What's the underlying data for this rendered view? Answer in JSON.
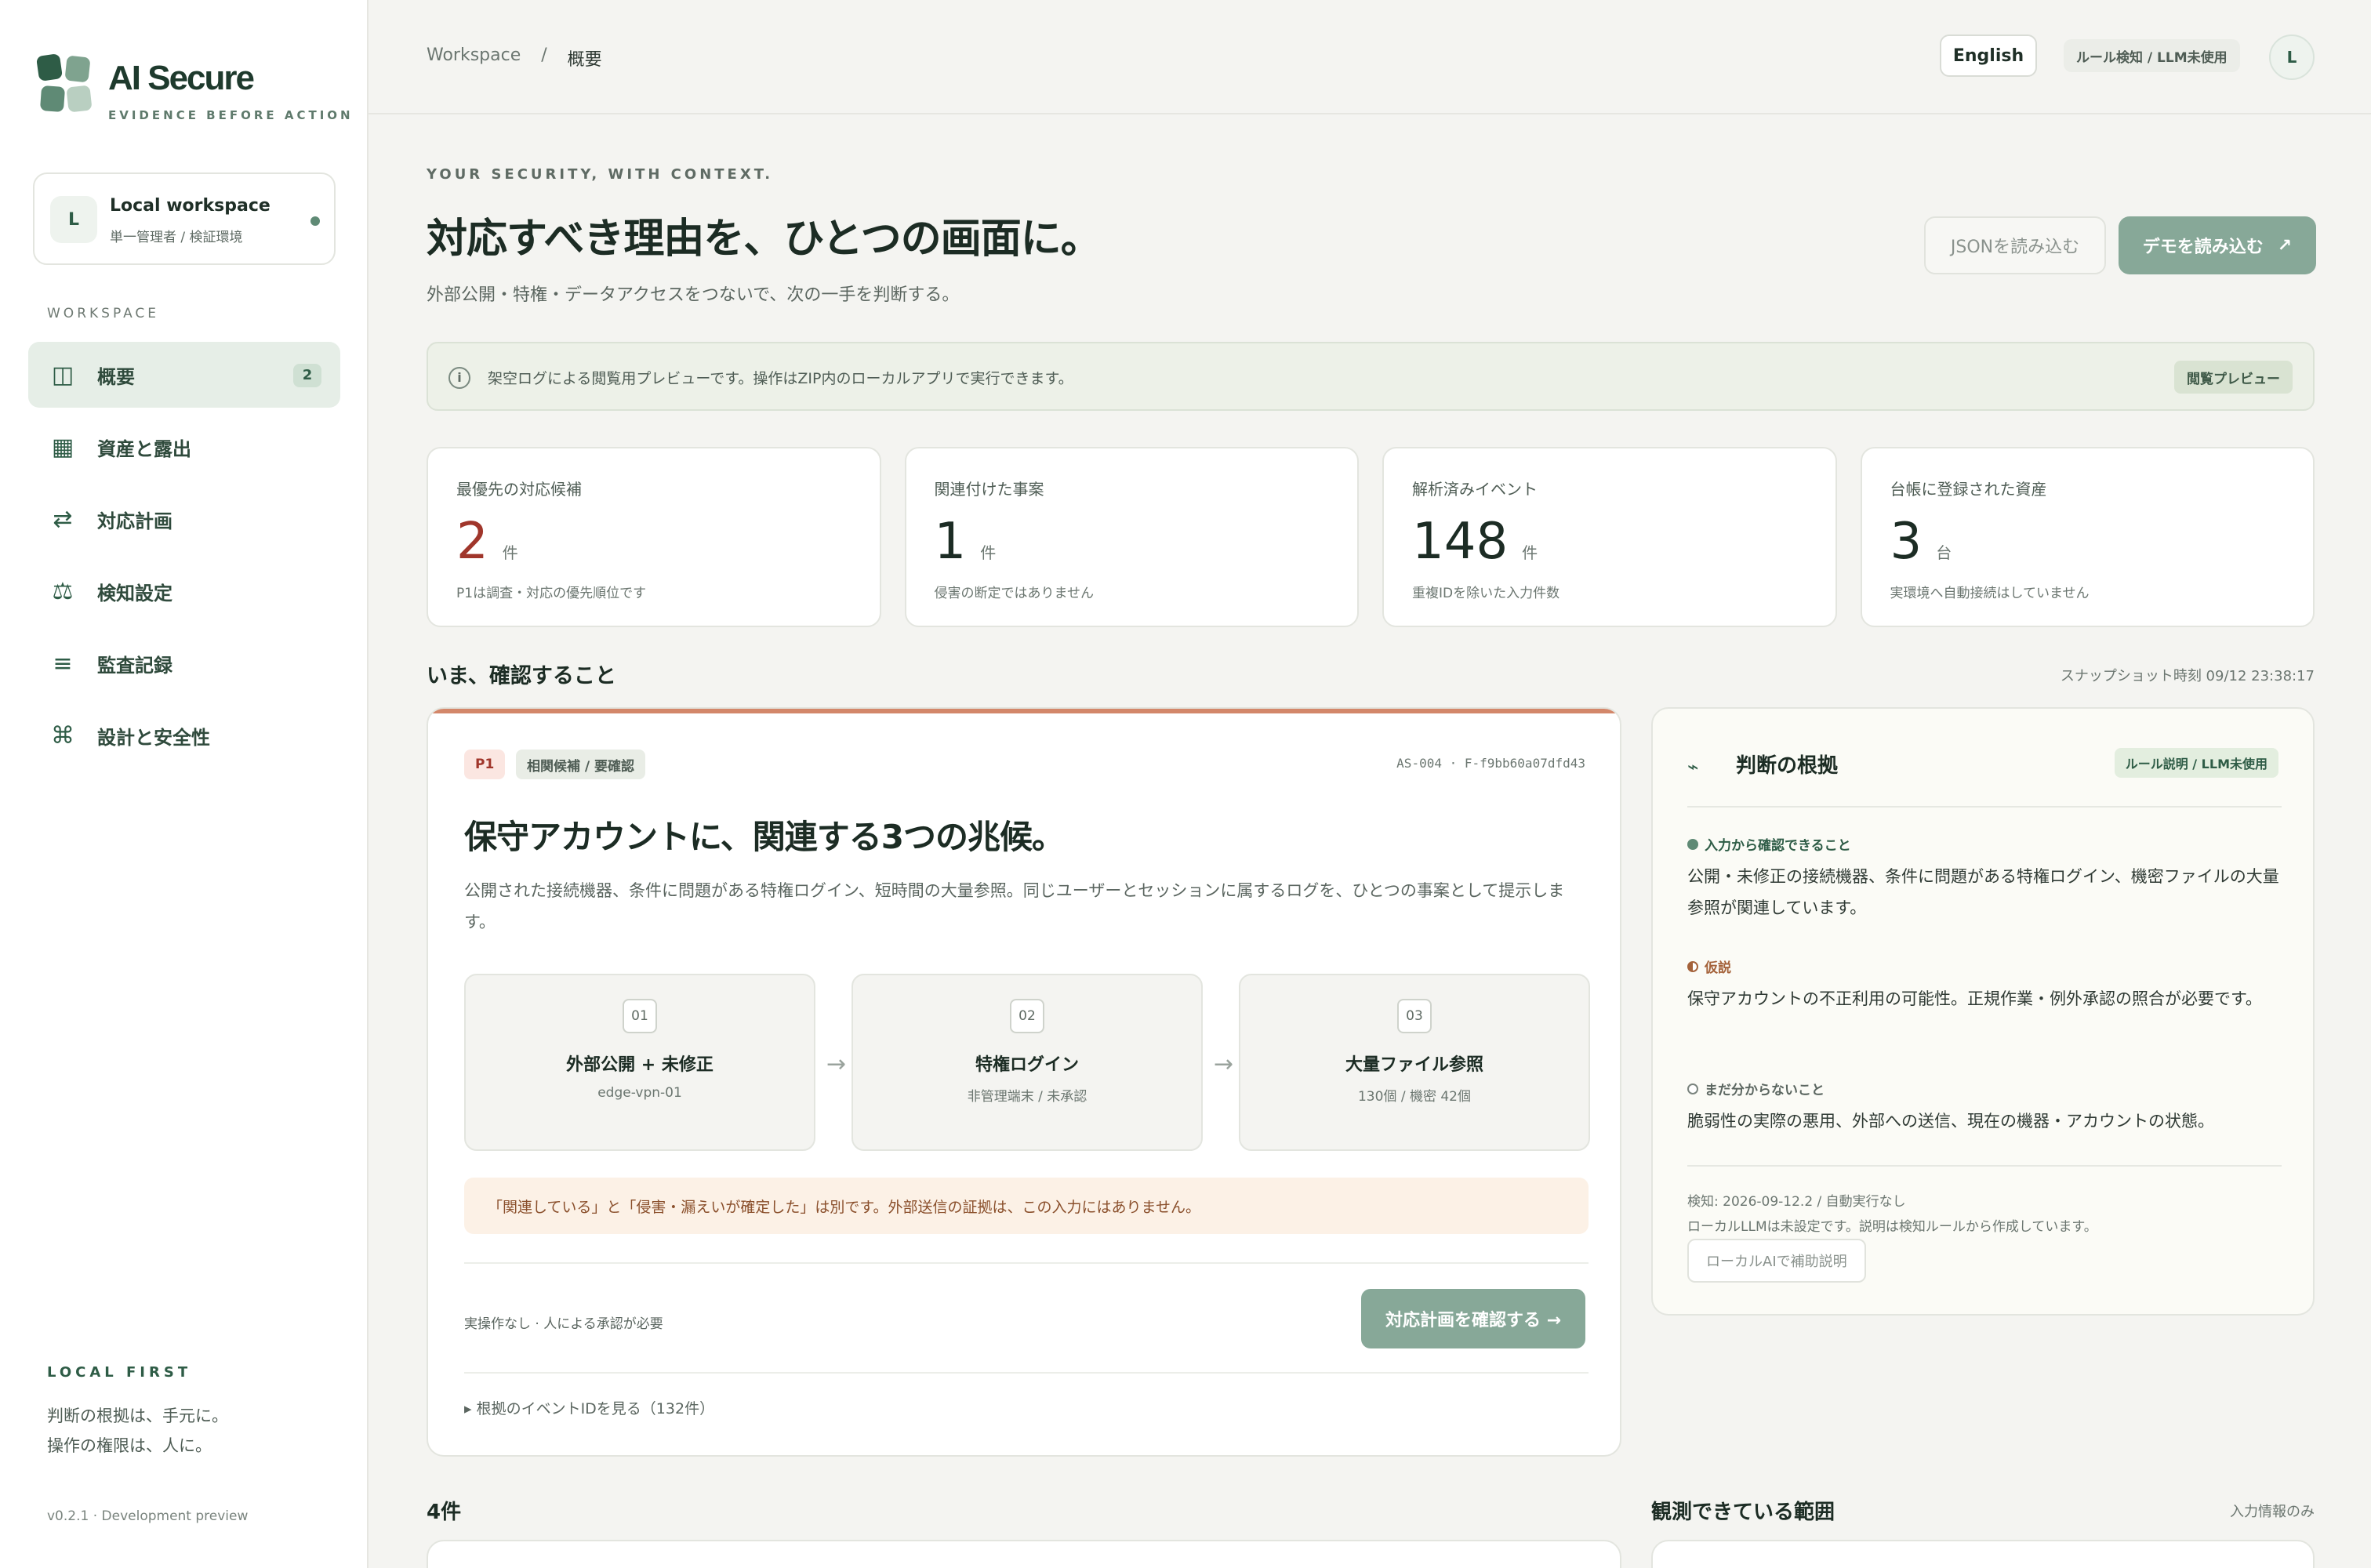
{
  "app": {
    "name": "AI Secure",
    "tagline": "EVIDENCE BEFORE ACTION"
  },
  "workspace": {
    "initial": "L",
    "name": "Local workspace",
    "sub": "単一管理者 / 検証環境"
  },
  "sidebar": {
    "section": "WORKSPACE",
    "items": [
      {
        "label": "概要",
        "icon": "overview-icon",
        "badge": "2"
      },
      {
        "label": "資産と露出",
        "icon": "grid-icon"
      },
      {
        "label": "対応計画",
        "icon": "swap-arrows-icon"
      },
      {
        "label": "検知設定",
        "icon": "scale-icon"
      },
      {
        "label": "監査記録",
        "icon": "list-icon"
      },
      {
        "label": "設計と安全性",
        "icon": "command-icon"
      }
    ],
    "local_first": {
      "title": "LOCAL FIRST",
      "line1": "判断の根拠は、手元に。",
      "line2": "操作の権限は、人に。"
    },
    "version": "v0.2.1 · Development preview"
  },
  "header": {
    "breadcrumb": [
      "Workspace",
      "/",
      "概要"
    ],
    "lang": "English",
    "mode": "ルール検知 / LLM未使用",
    "user_initial": "L"
  },
  "main": {
    "eyebrow": "YOUR SECURITY, WITH CONTEXT.",
    "title": "対応すべき理由を、ひとつの画面に。",
    "subtitle": "外部公開・特権・データアクセスをつないで、次の一手を判断する。",
    "btn_json": "JSONを読み込む",
    "btn_demo": "デモを読み込む",
    "btn_demo_icon": "↗",
    "notice": {
      "icon": "i",
      "text": "架空ログによる閲覧用プレビューです。操作はZIP内のローカルアプリで実行できます。",
      "badge": "閲覧プレビュー"
    },
    "stats": [
      {
        "label": "最優先の対応候補",
        "value": "2",
        "unit": "件",
        "note": "P1は調査・対応の優先順位です"
      },
      {
        "label": "関連付けた事案",
        "value": "1",
        "unit": "件",
        "note": "侵害の断定ではありません"
      },
      {
        "label": "解析済みイベント",
        "value": "148",
        "unit": "件",
        "note": "重複IDを除いた入力件数"
      },
      {
        "label": "台帳に登録された資産",
        "value": "3",
        "unit": "台",
        "note": "実環境へ自動接続はしていません"
      }
    ],
    "section_title": "いま、確認すること",
    "snapshot": "スナップショット時刻 09/12 23:38:17",
    "incident": {
      "priority": "P1",
      "status": "相関候補 / 要確認",
      "id": "AS-004 · F-f9bb60a07dfd43",
      "title": "保守アカウントに、関連する3つの兆候。",
      "description": "公開された接続機器、条件に問題がある特権ログイン、短時間の大量参照。同じユーザーとセッションに属するログを、ひとつの事案として提示します。",
      "steps": [
        {
          "num": "01",
          "title": "外部公開 + 未修正",
          "sub": "edge-vpn-01"
        },
        {
          "num": "02",
          "title": "特権ログイン",
          "sub": "非管理端末 / 未承認"
        },
        {
          "num": "03",
          "title": "大量ファイル参照",
          "sub": "130個 / 機密 42個"
        }
      ],
      "arrow": "→",
      "caution": "「関連している」と「侵害・漏えいが確定した」は別です。外部送信の証拠は、この入力にはありません。",
      "footer_note": "実操作なし · 人による承認が必要",
      "btn_plan": "対応計画を確認する →",
      "evidence_link": "▸ 根拠のイベントIDを見る（132件）"
    },
    "rationale": {
      "icon": "⌁",
      "title": "判断の根拠",
      "badge": "ルール説明 / LLM未使用",
      "confirmed_head": "入力から確認できること",
      "confirmed_body": "公開・未修正の接続機器、条件に問題がある特権ログイン、機密ファイルの大量参照が関連しています。",
      "hypothesis_head": "仮説",
      "hypothesis_body": "保守アカウントの不正利用の可能性。正規作業・例外承認の照合が必要です。",
      "unknown_head": "まだ分からないこと",
      "unknown_body": "脆弱性の実際の悪用、外部への送信、現在の機器・アカウントの状態。",
      "meta1": "検知: 2026-09-12.2 / 自動実行なし",
      "meta2": "ローカルLLMは未設定です。説明は検知ルールから作成しています。",
      "btn_ai": "ローカルAIで補助説明"
    },
    "bottom": {
      "left_title": "4件",
      "right_title": "観測できている範囲",
      "right_note": "入力情報のみ"
    }
  }
}
